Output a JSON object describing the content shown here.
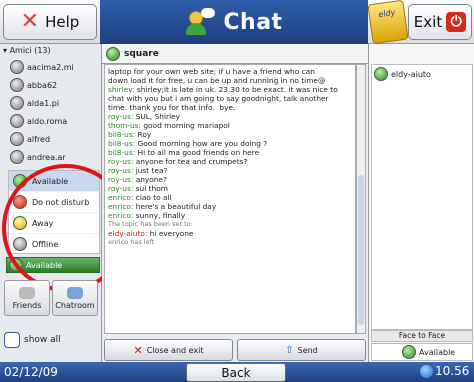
{
  "header": {
    "help_label": "Help",
    "title": "Chat",
    "eldy_label": "eldy",
    "exit_label": "Exit"
  },
  "left": {
    "group_label": "Amici (13)",
    "friends": [
      {
        "name": "aacima2.mi",
        "status": "gray"
      },
      {
        "name": "abba62",
        "status": "gray"
      },
      {
        "name": "alda1.pi",
        "status": "gray"
      },
      {
        "name": "aldo.roma",
        "status": "gray"
      },
      {
        "name": "alfred",
        "status": "gray"
      },
      {
        "name": "andrea.ar",
        "status": "gray"
      }
    ],
    "status_options": [
      {
        "label": "Available",
        "color": "green",
        "selected": true
      },
      {
        "label": "Do not disturb",
        "color": "red",
        "selected": false
      },
      {
        "label": "Away",
        "color": "yellow",
        "selected": false
      },
      {
        "label": "Offline",
        "color": "gray",
        "selected": false
      }
    ],
    "current_status": "Available",
    "friends_tab": "Friends",
    "chatroom_tab": "Chatroom",
    "show_all_label": "show all"
  },
  "chat": {
    "room_name": "square",
    "lines": [
      {
        "who": "",
        "text": "laptop for your own web site; if u have a friend who can",
        "kind": "cont"
      },
      {
        "who": "",
        "text": "down load it for free, u can be up and running in no time@",
        "kind": "cont"
      },
      {
        "who": "shirley:",
        "text": " shirley;it is late in uk. 23.30 to be exact. it was nice to",
        "kind": "msg"
      },
      {
        "who": "",
        "text": "chat with you but i am going to say goodnight, talk another",
        "kind": "cont"
      },
      {
        "who": "",
        "text": "time. thank you for that info.  bye.",
        "kind": "cont"
      },
      {
        "who": "roy-us:",
        "text": " SUL, Shirley",
        "kind": "msg"
      },
      {
        "who": "thom-us:",
        "text": " good morning mariapol",
        "kind": "msg"
      },
      {
        "who": "bil8-us:",
        "text": " Roy",
        "kind": "msg"
      },
      {
        "who": "bil8-us:",
        "text": " Good morning how are you doing ?",
        "kind": "msg"
      },
      {
        "who": "bil8-us:",
        "text": " Hi to all ma good friends on here",
        "kind": "msg"
      },
      {
        "who": "roy-us:",
        "text": " anyone for tea and crumpets?",
        "kind": "msg"
      },
      {
        "who": "roy-us:",
        "text": " just tea?",
        "kind": "msg"
      },
      {
        "who": "roy-us:",
        "text": " anyone?",
        "kind": "msg"
      },
      {
        "who": "roy-us:",
        "text": " sul thom",
        "kind": "msg"
      },
      {
        "who": "enrico:",
        "text": " ciao to all",
        "kind": "msg"
      },
      {
        "who": "enrico:",
        "text": " here's a beautiful day",
        "kind": "msg"
      },
      {
        "who": "enrico:",
        "text": " sunny, finally",
        "kind": "msg"
      },
      {
        "who": "",
        "text": "The topic has been set to:",
        "kind": "sys"
      },
      {
        "who": "eldy-aiuto:",
        "text": " hi everyone",
        "kind": "me"
      },
      {
        "who": "",
        "text": "enrico has left",
        "kind": "sys"
      }
    ],
    "close_label": "Close and exit",
    "send_label": "Send"
  },
  "right": {
    "users": [
      "eldy-aiuto"
    ],
    "face_to_face_label": "Face to Face",
    "status_label": "Available"
  },
  "footer": {
    "date": "02/12/09",
    "back_label": "Back",
    "time": "10.56"
  }
}
